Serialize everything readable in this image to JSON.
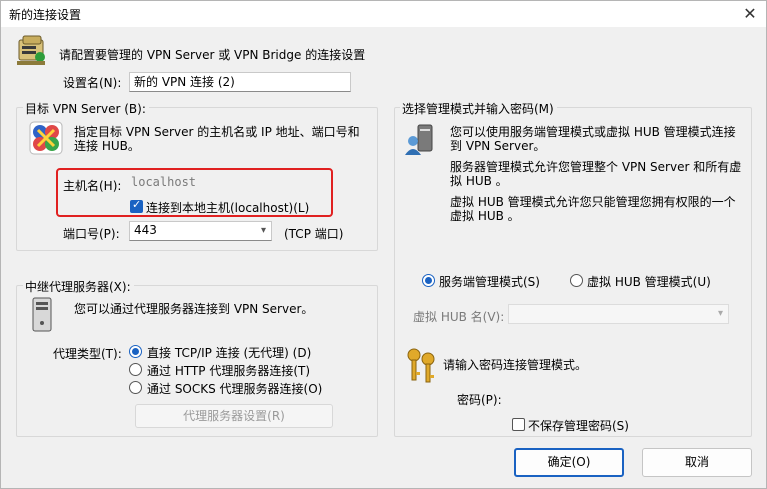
{
  "window": {
    "title": "新的连接设置",
    "close_glyph": "✕"
  },
  "header": {
    "description": "请配置要管理的 VPN Server 或 VPN Bridge 的连接设置",
    "setting_name_label": "设置名(N):",
    "setting_name_value": "新的 VPN 连接 (2)"
  },
  "target": {
    "legend": "目标 VPN Server (B):",
    "description_line1": "指定目标 VPN Server 的主机名或 IP 地址、端口号和",
    "description_line2": "连接 HUB。",
    "hostname_label": "主机名(H):",
    "hostname_placeholder": "localhost",
    "hostname_value": "",
    "localhost_checkbox_label": "连接到本地主机(localhost)(L)",
    "localhost_checked": true,
    "port_label": "端口号(P):",
    "port_value": "443",
    "port_unit": "(TCP 端口)"
  },
  "proxy": {
    "legend": "中继代理服务器(X):",
    "description": "您可以通过代理服务器连接到 VPN Server。",
    "type_label": "代理类型(T):",
    "options": [
      {
        "label": "直接 TCP/IP 连接 (无代理) (D)",
        "selected": true
      },
      {
        "label": "通过 HTTP 代理服务器连接(T)",
        "selected": false
      },
      {
        "label": "通过 SOCKS 代理服务器连接(O)",
        "selected": false
      }
    ],
    "settings_button": "代理服务器设置(R)"
  },
  "admin": {
    "legend": "选择管理模式并输入密码(M)",
    "desc1_line1": "您可以使用服务端管理模式或虚拟 HUB 管理模式连接",
    "desc1_line2": "到 VPN Server。",
    "desc2_line1": "服务器管理模式允许您管理整个 VPN Server 和所有虚",
    "desc2_line2": "拟 HUB 。",
    "desc3_line1": "虚拟 HUB 管理模式允许您只能管理您拥有权限的一个",
    "desc3_line2": "虚拟 HUB 。",
    "mode_server": "服务端管理模式(S)",
    "mode_server_selected": true,
    "mode_hub": "虚拟 HUB 管理模式(U)",
    "mode_hub_selected": false,
    "hub_name_label": "虚拟 HUB 名(V):",
    "hub_name_value": "",
    "password_prompt": "请输入密码连接管理模式。",
    "password_label": "密码(P):",
    "password_value": "",
    "no_save_password": "不保存管理密码(S)",
    "no_save_checked": false
  },
  "footer": {
    "ok_button": "确定(O)",
    "cancel_button": "取消"
  }
}
